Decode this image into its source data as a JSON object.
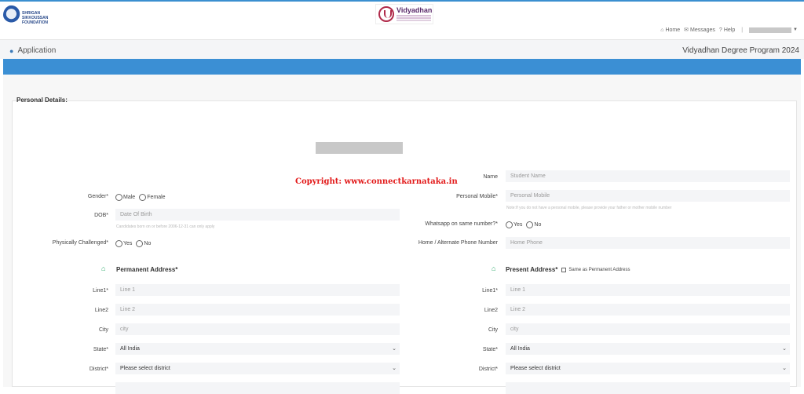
{
  "header": {
    "left_logo_text": [
      "SHRIGAN SIKKOUSSAN",
      "FOUNDATION"
    ],
    "center_logo_name": "Vidyadhan",
    "nav": [
      {
        "label": "Home",
        "icon": "home-icon"
      },
      {
        "label": "Messages",
        "icon": "envelope-icon"
      },
      {
        "label": "Help",
        "icon": "help-icon"
      }
    ]
  },
  "subheader": {
    "title": "Application",
    "program": "Vidyadhan Degree Program 2024"
  },
  "section": {
    "title": "Personal Details:"
  },
  "watermark": "Copyright: www.connectkarnataka.in",
  "left": {
    "gender_label": "Gender*",
    "gender_options": [
      "Male",
      "Female"
    ],
    "dob_label": "DOB*",
    "dob_placeholder": "Date Of Birth",
    "dob_hint": "Candidates born on or before 2006-12-31 can only apply",
    "pc_label": "Physically Challenged*",
    "pc_options": [
      "Yes",
      "No"
    ]
  },
  "right": {
    "name_label": "Name",
    "name_placeholder": "Student Name",
    "mobile_label": "Personal Mobile*",
    "mobile_placeholder": "Personal Mobile",
    "mobile_hint": "Note:If you do not have a personal mobile, please provide your father or mother mobile number",
    "whatsapp_label": "Whatsapp on same number?*",
    "whatsapp_options": [
      "Yes",
      "No"
    ],
    "home_phone_label": "Home / Alternate Phone Number",
    "home_phone_placeholder": "Home Phone"
  },
  "permanent": {
    "title": "Permanent Address*",
    "line1_label": "Line1*",
    "line1_placeholder": "Line 1",
    "line2_label": "Line2",
    "line2_placeholder": "Line 2",
    "city_label": "City",
    "city_placeholder": "city",
    "state_label": "State*",
    "state_value": "All India",
    "district_label": "District*",
    "district_value": "Please select district"
  },
  "present": {
    "title": "Present Address*",
    "same_label": "Same as Permanent Address",
    "line1_label": "Line1*",
    "line1_placeholder": "Line 1",
    "line2_label": "Line2",
    "line2_placeholder": "Line 2",
    "city_label": "City",
    "city_placeholder": "city",
    "state_label": "State*",
    "state_value": "All India",
    "district_label": "District*",
    "district_value": "Please select district"
  },
  "colors": {
    "accent_blue": "#3b8fd4",
    "watermark_red": "#e21818",
    "home_icon_green": "#2eaa6a"
  }
}
